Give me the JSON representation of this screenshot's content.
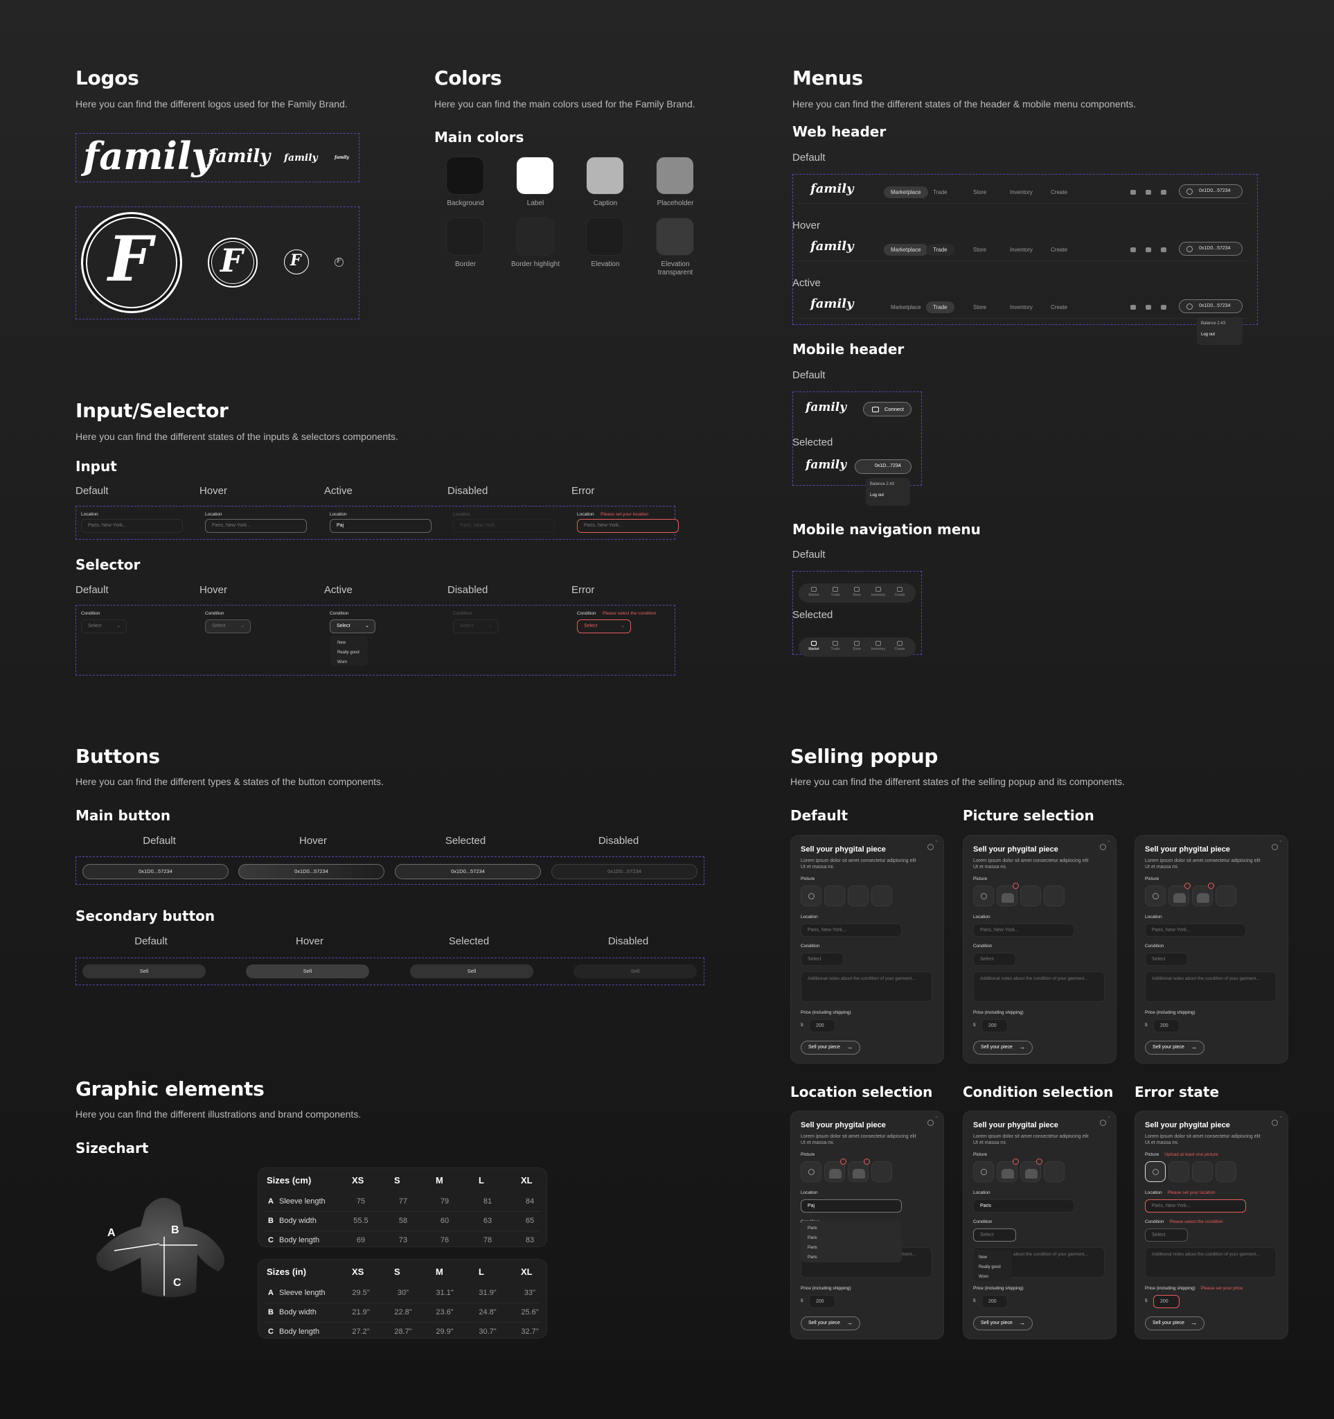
{
  "logos": {
    "title": "Logos",
    "desc": "Here you can find the different logos used for the Family Brand.",
    "wordmark": "family",
    "monogram": "F"
  },
  "colors": {
    "title": "Colors",
    "desc": "Here you can find the main colors used for the Family Brand.",
    "subtitle": "Main colors",
    "swatches": [
      {
        "label": "Background",
        "color": "#141414"
      },
      {
        "label": "Label",
        "color": "#ffffff"
      },
      {
        "label": "Caption",
        "color": "#b5b5b5"
      },
      {
        "label": "Placeholder",
        "color": "#8b8b8b"
      },
      {
        "label": "Border",
        "color": "#1e1e1e"
      },
      {
        "label": "Border highlight",
        "color": "#262626"
      },
      {
        "label": "Elevation",
        "color": "#1d1d1d"
      },
      {
        "label": "Elevation transparent",
        "color": "#3a3a3a"
      }
    ]
  },
  "menus": {
    "title": "Menus",
    "desc": "Here you can find the different states of the header & mobile menu components.",
    "web_header": "Web header",
    "default": "Default",
    "hover": "Hover",
    "active": "Active",
    "nav": [
      "Marketplace",
      "Trade",
      "Store",
      "Inventory",
      "Create"
    ],
    "wallet": "0x1D0...57234",
    "balance": "Balance  2.43",
    "logout": "Log out",
    "mobile_header": "Mobile header",
    "selected": "Selected",
    "connect": "Connect",
    "wallet_short": "0x1D...7234",
    "mobile_nav": "Mobile navigation menu",
    "mnav": [
      "Market",
      "Trade",
      "Store",
      "Inventory",
      "Create"
    ]
  },
  "inputs": {
    "title": "Input/Selector",
    "desc": "Here you can find the different states of the inputs & selectors components.",
    "input": "Input",
    "selector": "Selector",
    "states": [
      "Default",
      "Hover",
      "Active",
      "Disabled",
      "Error"
    ],
    "location": "Location",
    "placeholder": "Paris, New-York...",
    "typed": "Paj",
    "loc_error": "Please set your location",
    "condition": "Condition",
    "select": "Select",
    "cond_error": "Please select the condition",
    "options": [
      "New",
      "Really good",
      "Worn"
    ]
  },
  "buttons": {
    "title": "Buttons",
    "desc": "Here you can find the different types & states of the button components.",
    "main": "Main button",
    "secondary": "Secondary button",
    "states": [
      "Default",
      "Hover",
      "Selected",
      "Disabled"
    ],
    "wallet": "0x1D0...57234",
    "sell": "Sell"
  },
  "graphic": {
    "title": "Graphic elements",
    "desc": "Here you can find the different illustrations and brand components.",
    "sizechart": "Sizechart",
    "cm": {
      "head": [
        "Sizes (cm)",
        "XS",
        "S",
        "M",
        "L",
        "XL"
      ],
      "rows": [
        [
          "A",
          "Sleeve length",
          "75",
          "77",
          "79",
          "81",
          "84"
        ],
        [
          "B",
          "Body width",
          "55.5",
          "58",
          "60",
          "63",
          "65"
        ],
        [
          "C",
          "Body length",
          "69",
          "73",
          "76",
          "78",
          "83"
        ]
      ]
    },
    "in": {
      "head": [
        "Sizes (in)",
        "XS",
        "S",
        "M",
        "L",
        "XL"
      ],
      "rows": [
        [
          "A",
          "Sleeve length",
          "29.5\"",
          "30\"",
          "31.1\"",
          "31.9\"",
          "33\""
        ],
        [
          "B",
          "Body width",
          "21.9\"",
          "22.8\"",
          "23.6\"",
          "24.8\"",
          "25.6\""
        ],
        [
          "C",
          "Body length",
          "27.2\"",
          "28.7\"",
          "29.9\"",
          "30.7\"",
          "32.7\""
        ]
      ]
    },
    "markers": [
      "A",
      "B",
      "C"
    ]
  },
  "selling": {
    "title": "Selling popup",
    "desc": "Here you can find the different states of the selling popup and its components.",
    "states": [
      "Default",
      "Picture selection",
      "Location selection",
      "Condition selection",
      "Error state"
    ],
    "card_title": "Sell your phygital piece",
    "card_desc": "Lorem ipsum dolor sit amet consectetur adipiscing elit Ut et massa mi.",
    "picture": "Picture",
    "location": "Location",
    "condition": "Condition",
    "notes": "Additional notes about the condition of your garment...",
    "price": "Price (including shipping)",
    "currency": "$",
    "price_val": "200",
    "cta": "Sell your piece",
    "loc_placeholder": "Paris, New-York...",
    "select": "Select",
    "typed": "Paj",
    "typed_full": "Paris",
    "paris_opts": [
      "Paris",
      "Paris",
      "Paris",
      "Paris"
    ],
    "options": [
      "New",
      "Really good",
      "Worn"
    ],
    "err_pic": "Upload at least one picture",
    "err_loc": "Please set your location",
    "err_cond": "Please select the condition",
    "err_price": "Please set your price",
    "notes_short": "ent..."
  }
}
